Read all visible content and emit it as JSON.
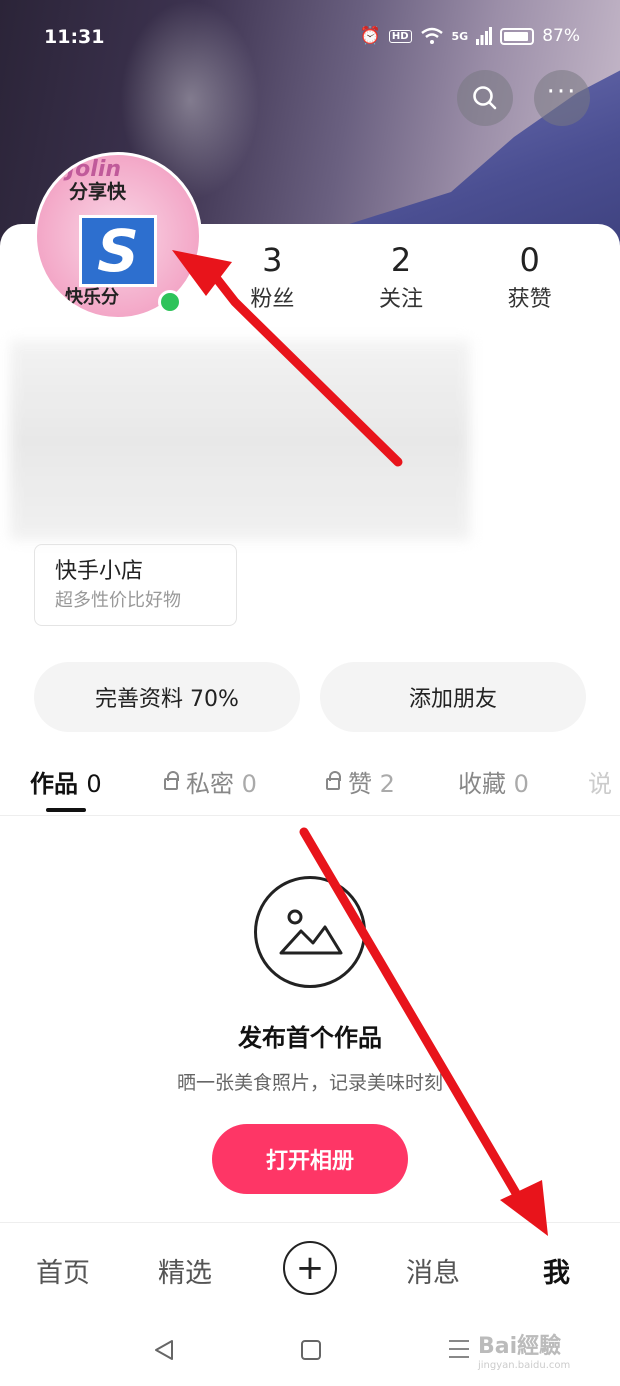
{
  "status_bar": {
    "time": "11:31",
    "hd": "HD",
    "network": "5G",
    "battery": "87%",
    "battery_level": 0.87
  },
  "avatar": {
    "top_text": "Jolin",
    "line1": "分享快",
    "line2": "快乐分",
    "logo_letter": "S"
  },
  "stats": [
    {
      "value": "3",
      "label": "粉丝"
    },
    {
      "value": "2",
      "label": "关注"
    },
    {
      "value": "0",
      "label": "获赞"
    }
  ],
  "shop": {
    "title": "快手小店",
    "subtitle": "超多性价比好物"
  },
  "actions": {
    "complete_profile": "完善资料 70%",
    "add_friend": "添加朋友"
  },
  "tabs": [
    {
      "label": "作品",
      "count": "0",
      "locked": false,
      "active": true
    },
    {
      "label": "私密",
      "count": "0",
      "locked": true,
      "active": false
    },
    {
      "label": "赞",
      "count": "2",
      "locked": true,
      "active": false
    },
    {
      "label": "收藏",
      "count": "0",
      "locked": false,
      "active": false
    },
    {
      "label": "说",
      "count": "",
      "locked": false,
      "active": false
    }
  ],
  "empty_state": {
    "title": "发布首个作品",
    "subtitle": "晒一张美食照片，记录美味时刻",
    "button": "打开相册"
  },
  "bottom_nav": {
    "home": "首页",
    "featured": "精选",
    "plus": "+",
    "messages": "消息",
    "me": "我"
  },
  "watermark": {
    "brand": "Bai經驗",
    "url": "jingyan.baidu.com"
  },
  "colors": {
    "accent": "#fe3666",
    "online": "#2ec35a",
    "annotation_arrow": "#e8141b"
  }
}
